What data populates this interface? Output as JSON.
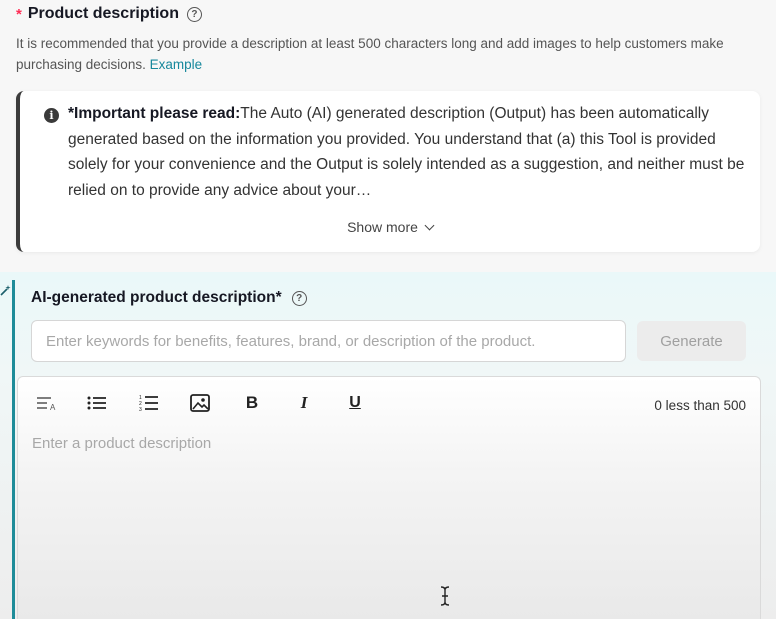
{
  "section": {
    "required_mark": "*",
    "title": "Product description",
    "hint": "It is recommended that you provide a description at least 500 characters long and add images to help customers make purchasing decisions.",
    "example_link": "Example"
  },
  "notice": {
    "bold_prefix": "*Important please read:",
    "text": "The Auto (AI) generated description (Output) has been automatically generated based on the information you provided. You understand that (a) this Tool is provided solely for your convenience and the Output is solely intended as a suggestion, and neither must be relied on to provide any advice about your…",
    "show_more": "Show more"
  },
  "ai": {
    "title": "AI-generated product description*",
    "keywords_placeholder": "Enter keywords for benefits, features, brand, or description of the product.",
    "generate_label": "Generate"
  },
  "editor": {
    "bold": "B",
    "italic": "I",
    "underline": "U",
    "counter": "0 less than 500",
    "placeholder": "Enter a product description"
  },
  "icons": [
    "help-icon",
    "info-icon",
    "chevron-down-icon",
    "magic-wand-icon",
    "text-format-icon",
    "bulleted-list-icon",
    "numbered-list-icon",
    "image-icon",
    "text-cursor-icon"
  ]
}
